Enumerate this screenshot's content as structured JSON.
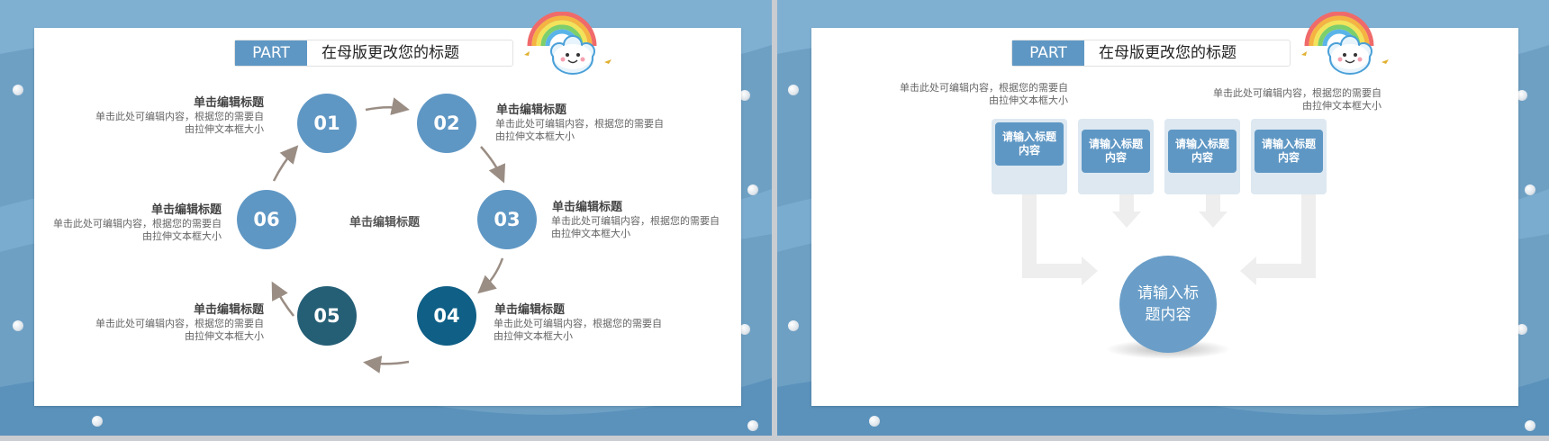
{
  "slides": [
    {
      "part_label": "PART",
      "title": "在母版更改您的标题",
      "center_label": "单击编辑标题",
      "items": [
        {
          "num": "01",
          "title": "单击编辑标题",
          "desc_line1": "单击此处可编辑内容，根据您的需要自",
          "desc_line2": "由拉伸文本框大小"
        },
        {
          "num": "02",
          "title": "单击编辑标题",
          "desc_line1": "单击此处可编辑内容，根据您的需要自",
          "desc_line2": "由拉伸文本框大小"
        },
        {
          "num": "03",
          "title": "单击编辑标题",
          "desc_line1": "单击此处可编辑内容，根据您的需要自",
          "desc_line2": "由拉伸文本框大小"
        },
        {
          "num": "04",
          "title": "单击编辑标题",
          "desc_line1": "单击此处可编辑内容，根据您的需要自",
          "desc_line2": "由拉伸文本框大小"
        },
        {
          "num": "05",
          "title": "单击编辑标题",
          "desc_line1": "单击此处可编辑内容，根据您的需要自",
          "desc_line2": "由拉伸文本框大小"
        },
        {
          "num": "06",
          "title": "单击编辑标题",
          "desc_line1": "单击此处可编辑内容，根据您的需要自",
          "desc_line2": "由拉伸文本框大小"
        }
      ]
    },
    {
      "part_label": "PART",
      "title": "在母版更改您的标题",
      "text_left_line1": "单击此处可编辑内容，根据您的需要自",
      "text_left_line2": "由拉伸文本框大小",
      "text_right_line1": "单击此处可编辑内容，根据您的需要自",
      "text_right_line2": "由拉伸文本框大小",
      "boxes": [
        "请输入标题内容",
        "请输入标题内容",
        "请输入标题内容",
        "请输入标题内容"
      ],
      "center": "请输入标题内容"
    }
  ],
  "colors": {
    "background": "#6ea0c4",
    "accent": "#5f97c4",
    "dark_teal": "#255f76",
    "dark_blue": "#0f5f86",
    "arrow": "#9a8d84"
  }
}
